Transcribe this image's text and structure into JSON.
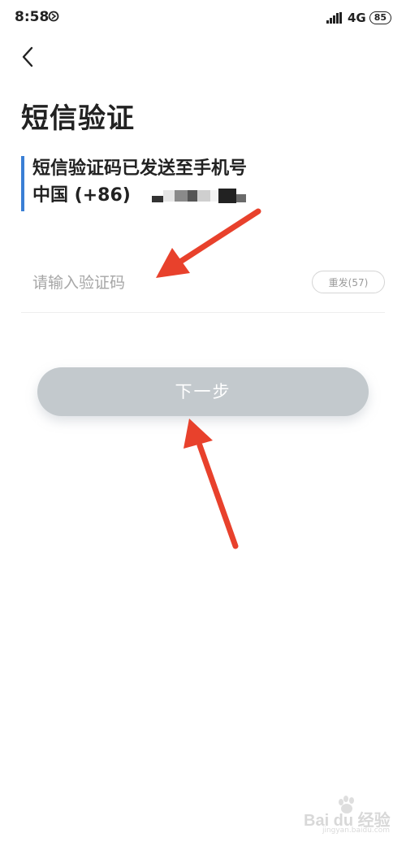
{
  "status_bar": {
    "time": "8:58",
    "network": "4G",
    "battery": "85"
  },
  "header": {
    "title": "短信验证"
  },
  "info": {
    "line1": "短信验证码已发送至手机号",
    "country_code": "中国 (+86)"
  },
  "form": {
    "code_placeholder": "请输入验证码",
    "resend_label": "重发(57)"
  },
  "actions": {
    "next_label": "下一步"
  },
  "watermark": {
    "brand": "Bai du 经验",
    "site": "jingyan.baidu.com"
  },
  "colors": {
    "accent": "#3a7fd5",
    "button_disabled": "#c3c9cd",
    "annotation_arrow": "#e8412c"
  }
}
